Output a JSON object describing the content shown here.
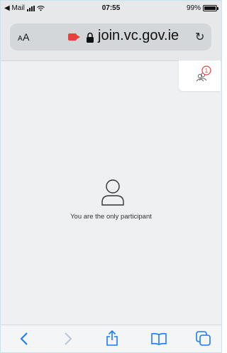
{
  "status_bar": {
    "back_app": "◀ Mail",
    "time": "07:55",
    "battery_percent": "99%",
    "battery_level": 0.99
  },
  "address_bar": {
    "text_size_label": "AA",
    "url": "join.vc.gov.ie",
    "recording_color": "#e8413c"
  },
  "participants_button": {
    "badge_count": "1",
    "icon": "participants-icon"
  },
  "main": {
    "empty_icon": "person-outline-icon",
    "message": "You are the only participant"
  },
  "toolbar": {
    "items": [
      "back-icon",
      "forward-icon",
      "share-icon",
      "bookmarks-icon",
      "tabs-icon"
    ]
  },
  "colors": {
    "accent": "#1a7aff",
    "badge": "#e8413c"
  }
}
